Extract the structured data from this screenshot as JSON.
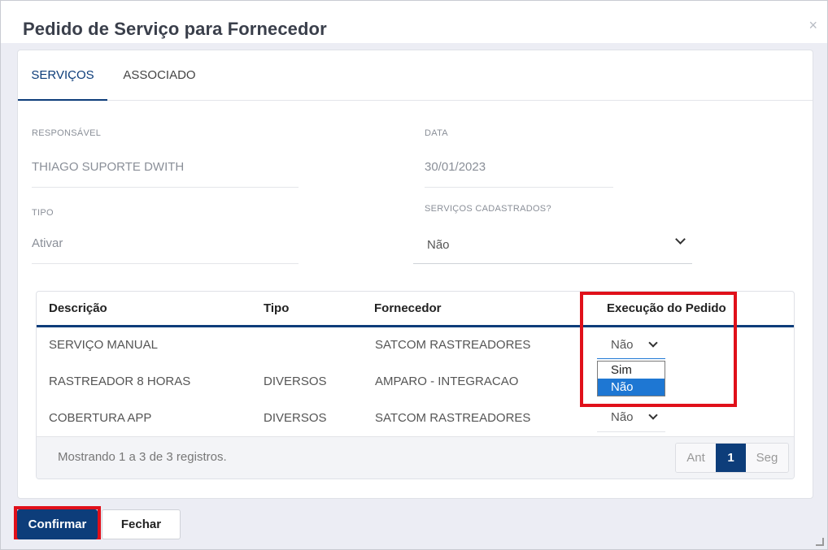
{
  "modal": {
    "title": "Pedido de Serviço para Fornecedor",
    "close_label": "×"
  },
  "tabs": [
    {
      "label": "SERVIÇOS",
      "active": true
    },
    {
      "label": "ASSOCIADO",
      "active": false
    }
  ],
  "form": {
    "responsavel": {
      "label": "RESPONSÁVEL",
      "value": "THIAGO SUPORTE DWITH"
    },
    "data": {
      "label": "DATA",
      "value": "30/01/2023"
    },
    "tipo": {
      "label": "TIPO",
      "value": "Ativar"
    },
    "servicos_cadastrados": {
      "label": "SERVIÇOS CADASTRADOS?",
      "value": "Não"
    }
  },
  "table": {
    "columns": [
      "Descrição",
      "Tipo",
      "Fornecedor",
      "Execução do Pedido"
    ],
    "rows": [
      {
        "descricao": "SERVIÇO MANUAL",
        "tipo": "",
        "fornecedor": "SATCOM RASTREADORES",
        "execucao": "Não"
      },
      {
        "descricao": "RASTREADOR 8 HORAS",
        "tipo": "DIVERSOS",
        "fornecedor": "AMPARO - INTEGRACAO",
        "execucao": "Não"
      },
      {
        "descricao": "COBERTURA APP",
        "tipo": "DIVERSOS",
        "fornecedor": "SATCOM RASTREADORES",
        "execucao": "Não"
      }
    ],
    "dropdown_options": [
      {
        "label": "Sim",
        "selected": false
      },
      {
        "label": "Não",
        "selected": true
      }
    ],
    "footer": {
      "showing": "Mostrando 1 a 3 de 3 registros."
    },
    "pagination": {
      "prev": "Ant",
      "current": "1",
      "next": "Seg"
    }
  },
  "buttons": {
    "confirm": "Confirmar",
    "close": "Fechar"
  },
  "colors": {
    "primary": "#0d3d7a",
    "highlight": "#e0101a",
    "dropdown_selected": "#1e77d3"
  }
}
